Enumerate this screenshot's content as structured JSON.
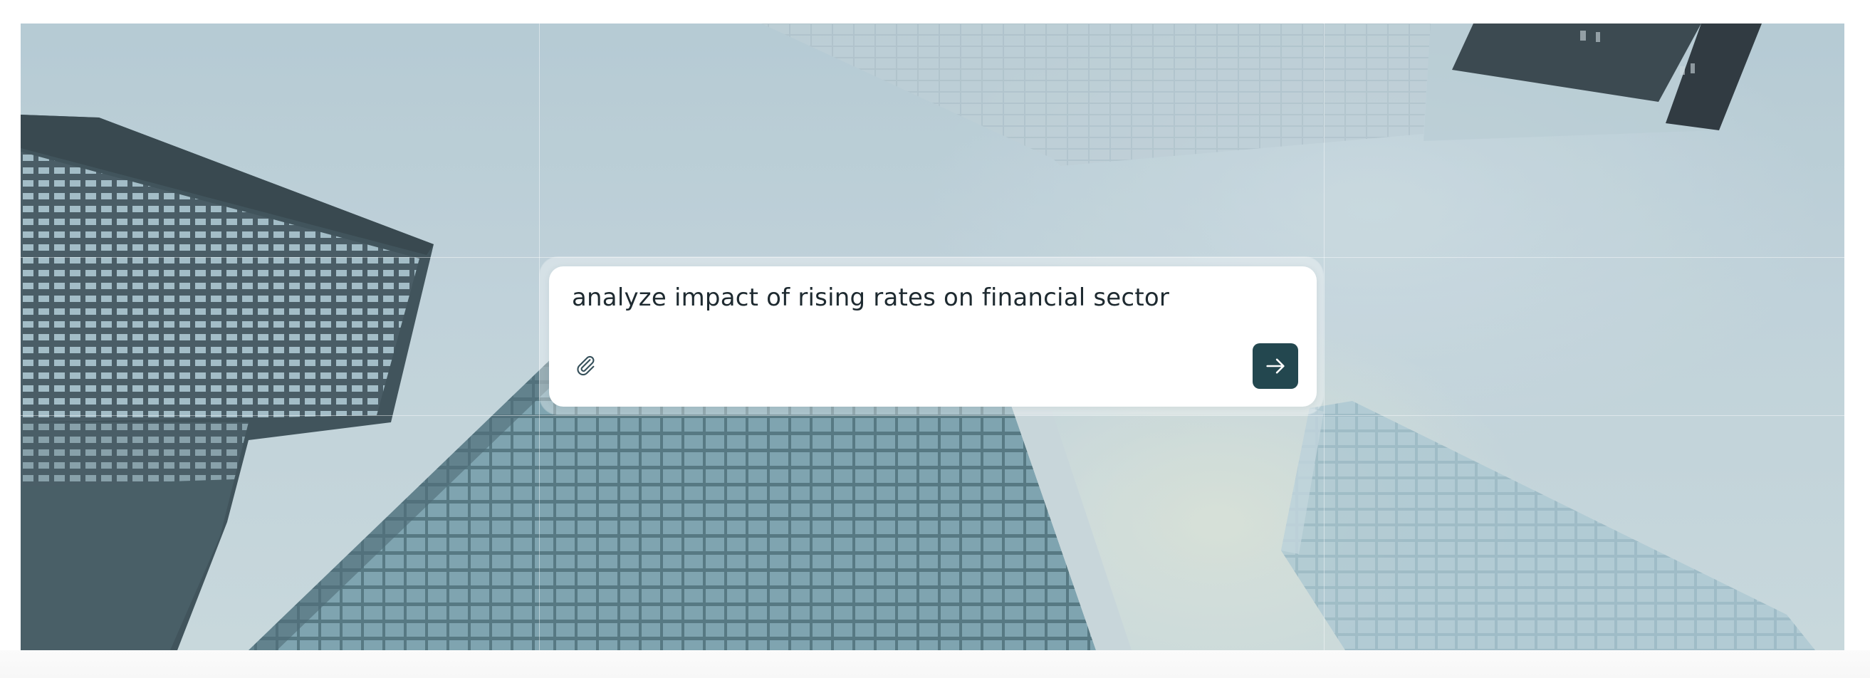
{
  "prompt": {
    "text": "analyze impact of rising rates on financial sector"
  },
  "icons": {
    "attach": "paperclip-icon",
    "send": "arrow-right-icon"
  },
  "colors": {
    "send_button": "#23474f",
    "text": "#1e2a30",
    "sky": "#bfd1d9"
  }
}
